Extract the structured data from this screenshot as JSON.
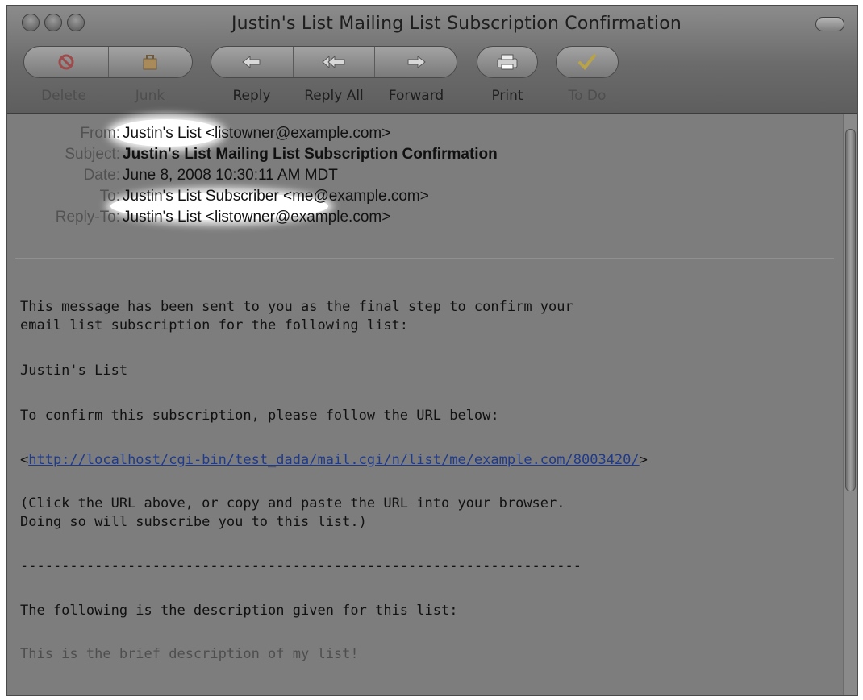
{
  "window": {
    "title": "Justin's List Mailing List Subscription Confirmation"
  },
  "toolbar": {
    "buttons": [
      {
        "label": "Delete",
        "enabled": false
      },
      {
        "label": "Junk",
        "enabled": false
      },
      {
        "label": "Reply",
        "enabled": true
      },
      {
        "label": "Reply All",
        "enabled": true
      },
      {
        "label": "Forward",
        "enabled": true
      },
      {
        "label": "Print",
        "enabled": true
      },
      {
        "label": "To Do",
        "enabled": false
      }
    ]
  },
  "headers": {
    "from_key": "From:",
    "from_name": "Justin's List",
    "from_addr": "<listowner@example.com>",
    "subject_key": "Subject:",
    "subject": "Justin's List Mailing List Subscription Confirmation",
    "date_key": "Date:",
    "date": "June 8, 2008 10:30:11 AM MDT",
    "to_key": "To:",
    "to_name": "Justin's List Subscriber",
    "to_addr": "<me@example.com>",
    "replyto_key": "Reply-To:",
    "replyto": "Justin's List <listowner@example.com>"
  },
  "body": {
    "intro_1": "This message has been sent to you as the final step to confirm your",
    "intro_2": "email list subscription for the following list:",
    "list_name": "Justin's List",
    "confirm": "To confirm this subscription, please follow the URL below:",
    "url_open": "<",
    "url": "http://localhost/cgi-bin/test_dada/mail.cgi/n/list/me/example.com/8003420/",
    "url_close": ">",
    "note_1": "(Click the URL above, or copy and paste the URL into your browser.",
    "note_2": "Doing so will subscribe you to this list.)",
    "separator": "--------------------------------------------------------------------",
    "desc_intro": "The following is the description given for this list:",
    "desc": "This is the brief description of my list!"
  },
  "colors": {
    "highlight": "#ffffff",
    "link": "#203a8a",
    "window_bg": "#7d7d7d"
  }
}
